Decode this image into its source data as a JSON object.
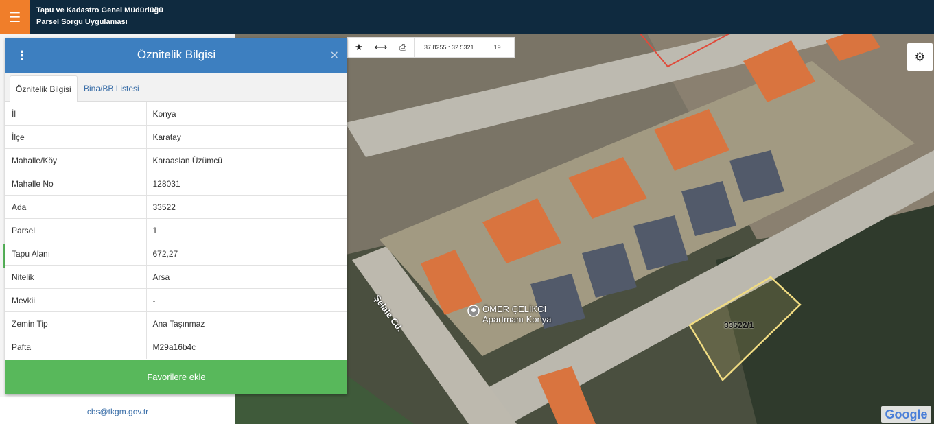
{
  "header": {
    "menu_icon": "☰",
    "title_line1": "Tapu ve Kadastro Genel Müdürlüğü",
    "title_line2": "Parsel Sorgu Uygulaması"
  },
  "sidebar": {
    "email": "cbs@tkgm.gov.tr"
  },
  "toolbar": {
    "star_icon": "★",
    "measure_icon": "⟷",
    "print_icon": "⎙",
    "coordinates": "37.8255 : 32.5321",
    "zoom": "19"
  },
  "settings_icon": "⚙",
  "panel": {
    "kebab_icon": "⋮",
    "title": "Öznitelik Bilgisi",
    "close_icon": "×",
    "tabs": [
      {
        "label": "Öznitelik Bilgisi",
        "active": true
      },
      {
        "label": "Bina/BB Listesi",
        "active": false
      }
    ],
    "rows": [
      {
        "key": "İl",
        "value": "Konya"
      },
      {
        "key": "İlçe",
        "value": "Karatay"
      },
      {
        "key": "Mahalle/Köy",
        "value": "Karaaslan Üzümcü"
      },
      {
        "key": "Mahalle No",
        "value": "128031"
      },
      {
        "key": "Ada",
        "value": "33522"
      },
      {
        "key": "Parsel",
        "value": "1"
      },
      {
        "key": "Tapu Alanı",
        "value": "672,27"
      },
      {
        "key": "Nitelik",
        "value": "Arsa"
      },
      {
        "key": "Mevkii",
        "value": "-"
      },
      {
        "key": "Zemin Tip",
        "value": "Ana Taşınmaz"
      },
      {
        "key": "Pafta",
        "value": "M29a16b4c"
      }
    ],
    "favorite_label": "Favorilere ekle"
  },
  "map": {
    "street_label": "Şelale Cd.",
    "poi_line1": "ÖMER ÇELİKCİ",
    "poi_line2": "Apartmanı Konya",
    "parcel_label": "33522/1",
    "google_logo": "Google"
  },
  "colors": {
    "header_bg": "#0f2a3f",
    "menu_orange": "#f07e2a",
    "panel_blue": "#3d7fc0",
    "favorite_green": "#58b85b",
    "parcel_outline": "#f1dc82"
  }
}
